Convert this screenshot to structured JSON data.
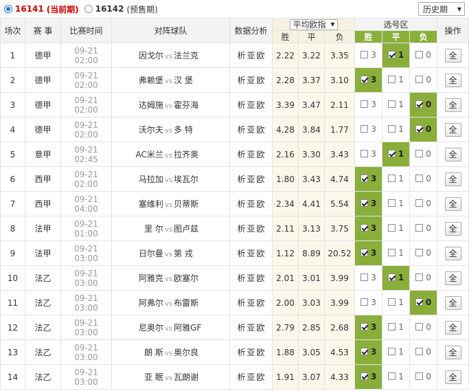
{
  "periods": {
    "current": {
      "number": "16141",
      "tag": "(当前期)"
    },
    "next": {
      "number": "16142",
      "tag": "(预售期)"
    }
  },
  "history_label": "历史期",
  "headers": {
    "round": "场次",
    "league": "赛 事",
    "time": "比赛时间",
    "teams": "对阵球队",
    "analysis": "数据分析",
    "odds_select": "平均欧指",
    "selection_zone": "选号区",
    "action": "操作",
    "win": "胜",
    "draw": "平",
    "lose": "负"
  },
  "vs_label": "vs",
  "analysis_links": [
    "析",
    "亚",
    "欧"
  ],
  "all_button": "全",
  "matches": [
    {
      "no": "1",
      "league": "德甲",
      "time": "09-21 02:00",
      "home": "因戈尔",
      "away": "法兰克",
      "odds": [
        "2.22",
        "3.22",
        "3.35"
      ],
      "picks": [
        "3",
        "1",
        "0"
      ],
      "selected": [
        false,
        true,
        false
      ]
    },
    {
      "no": "2",
      "league": "德甲",
      "time": "09-21 02:00",
      "home": "弗赖堡",
      "away": "汉 堡",
      "odds": [
        "2.28",
        "3.37",
        "3.10"
      ],
      "picks": [
        "3",
        "1",
        "0"
      ],
      "selected": [
        true,
        false,
        false
      ]
    },
    {
      "no": "3",
      "league": "德甲",
      "time": "09-21 02:00",
      "home": "达姆施",
      "away": "霍芬海",
      "odds": [
        "3.39",
        "3.47",
        "2.11"
      ],
      "picks": [
        "3",
        "1",
        "0"
      ],
      "selected": [
        false,
        false,
        true
      ]
    },
    {
      "no": "4",
      "league": "德甲",
      "time": "09-21 02:00",
      "home": "沃尔夫",
      "away": "多 特",
      "odds": [
        "4.28",
        "3.84",
        "1.77"
      ],
      "picks": [
        "3",
        "1",
        "0"
      ],
      "selected": [
        false,
        false,
        true
      ]
    },
    {
      "no": "5",
      "league": "意甲",
      "time": "09-21 02:45",
      "home": "AC米兰",
      "away": "拉齐奥",
      "odds": [
        "2.16",
        "3.30",
        "3.43"
      ],
      "picks": [
        "3",
        "1",
        "0"
      ],
      "selected": [
        false,
        true,
        false
      ]
    },
    {
      "no": "6",
      "league": "西甲",
      "time": "09-21 02:00",
      "home": "马拉加",
      "away": "埃瓦尔",
      "odds": [
        "1.80",
        "3.43",
        "4.74"
      ],
      "picks": [
        "3",
        "1",
        "0"
      ],
      "selected": [
        true,
        false,
        false
      ]
    },
    {
      "no": "7",
      "league": "西甲",
      "time": "09-21 04:00",
      "home": "塞维利",
      "away": "贝蒂斯",
      "odds": [
        "2.34",
        "4.41",
        "5.54"
      ],
      "picks": [
        "3",
        "1",
        "0"
      ],
      "selected": [
        true,
        false,
        false
      ]
    },
    {
      "no": "8",
      "league": "法甲",
      "time": "09-21 01:00",
      "home": "里 尔",
      "away": "图卢兹",
      "odds": [
        "2.11",
        "3.13",
        "3.75"
      ],
      "picks": [
        "3",
        "1",
        "0"
      ],
      "selected": [
        true,
        false,
        false
      ]
    },
    {
      "no": "9",
      "league": "法甲",
      "time": "09-21 03:00",
      "home": "日尔曼",
      "away": "第 戎",
      "odds": [
        "1.12",
        "8.89",
        "20.52"
      ],
      "picks": [
        "3",
        "1",
        "0"
      ],
      "selected": [
        true,
        false,
        false
      ]
    },
    {
      "no": "10",
      "league": "法乙",
      "time": "09-21 03:00",
      "home": "阿雅克",
      "away": "欧塞尔",
      "odds": [
        "2.01",
        "3.01",
        "3.99"
      ],
      "picks": [
        "3",
        "1",
        "0"
      ],
      "selected": [
        false,
        true,
        false
      ]
    },
    {
      "no": "11",
      "league": "法乙",
      "time": "09-21 03:00",
      "home": "阿弗尔",
      "away": "布雷斯",
      "odds": [
        "2.00",
        "3.03",
        "3.99"
      ],
      "picks": [
        "3",
        "1",
        "0"
      ],
      "selected": [
        false,
        false,
        true
      ]
    },
    {
      "no": "12",
      "league": "法乙",
      "time": "09-21 03:00",
      "home": "尼奥尔",
      "away": "阿雅GF",
      "odds": [
        "2.79",
        "2.85",
        "2.68"
      ],
      "picks": [
        "3",
        "1",
        "0"
      ],
      "selected": [
        true,
        false,
        false
      ]
    },
    {
      "no": "13",
      "league": "法乙",
      "time": "09-21 03:00",
      "home": "朗 斯",
      "away": "奥尔良",
      "odds": [
        "1.88",
        "3.05",
        "4.53"
      ],
      "picks": [
        "3",
        "1",
        "0"
      ],
      "selected": [
        true,
        false,
        false
      ]
    },
    {
      "no": "14",
      "league": "法乙",
      "time": "09-21 03:00",
      "home": "亚 眠",
      "away": "瓦朗谢",
      "odds": [
        "1.91",
        "3.07",
        "4.33"
      ],
      "picks": [
        "3",
        "1",
        "0"
      ],
      "selected": [
        true,
        false,
        false
      ]
    }
  ],
  "colors": {
    "selected_green": "#8aae3a",
    "current_red": "#cc0000",
    "odds_bg": "#fbf7ea"
  }
}
